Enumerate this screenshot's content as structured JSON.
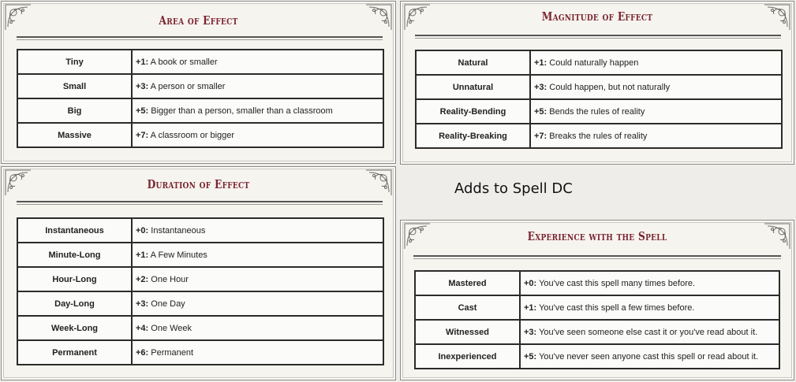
{
  "note": "Adds to Spell DC",
  "colors": {
    "title": "#7a2430",
    "panel": "#f6f4ef",
    "border": "#2b2b2b"
  },
  "area": {
    "title": "Area of Effect",
    "rows": [
      {
        "name": "Tiny",
        "mod": "+1:",
        "desc": " A book or smaller"
      },
      {
        "name": "Small",
        "mod": "+3:",
        "desc": " A person or smaller"
      },
      {
        "name": "Big",
        "mod": "+5:",
        "desc": " Bigger than a person, smaller than a classroom"
      },
      {
        "name": "Massive",
        "mod": "+7:",
        "desc": " A classroom or bigger"
      }
    ]
  },
  "magnitude": {
    "title": "Magnitude of Effect",
    "rows": [
      {
        "name": "Natural",
        "mod": "+1:",
        "desc": " Could naturally happen"
      },
      {
        "name": "Unnatural",
        "mod": "+3:",
        "desc": " Could happen, but not naturally"
      },
      {
        "name": "Reality-Bending",
        "mod": "+5:",
        "desc": " Bends the rules of reality"
      },
      {
        "name": "Reality-Breaking",
        "mod": "+7:",
        "desc": " Breaks the rules of reality"
      }
    ]
  },
  "duration": {
    "title": "Duration of Effect",
    "rows": [
      {
        "name": "Instantaneous",
        "mod": "+0:",
        "desc": " Instantaneous"
      },
      {
        "name": "Minute-Long",
        "mod": "+1:",
        "desc": " A Few Minutes"
      },
      {
        "name": "Hour-Long",
        "mod": "+2:",
        "desc": " One Hour"
      },
      {
        "name": "Day-Long",
        "mod": "+3:",
        "desc": " One Day"
      },
      {
        "name": "Week-Long",
        "mod": "+4:",
        "desc": " One Week"
      },
      {
        "name": "Permanent",
        "mod": "+6:",
        "desc": " Permanent"
      }
    ]
  },
  "experience": {
    "title": "Experience with the Spell",
    "rows": [
      {
        "name": "Mastered",
        "mod": "+0:",
        "desc": " You've cast this spell many times before."
      },
      {
        "name": "Cast",
        "mod": "+1:",
        "desc": " You've cast this spell a few times before."
      },
      {
        "name": "Witnessed",
        "mod": "+3:",
        "desc": " You've seen someone else cast it or you've read about it."
      },
      {
        "name": "Inexperienced",
        "mod": "+5:",
        "desc": " You've never seen anyone cast this spell or read about it."
      }
    ]
  }
}
